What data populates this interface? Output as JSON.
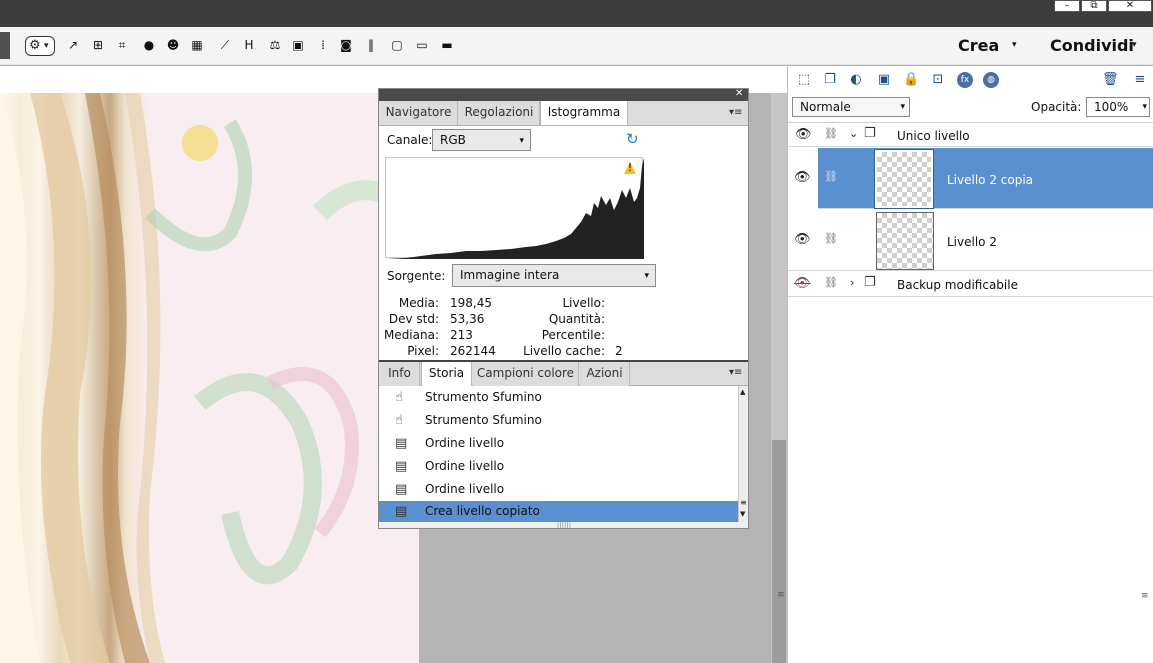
{
  "window": {
    "minimize": "–",
    "restore": "⧉",
    "close": "✕"
  },
  "toolbar": {
    "icons": [
      "gear-icon",
      "external-icon",
      "dashboard-icon",
      "crop-icon",
      "person-icon",
      "smile-icon",
      "grid-icon",
      "chart-icon",
      "h-icon",
      "balance-icon",
      "image-icon",
      "dots-icon",
      "camera-icon",
      "pause-icon",
      "frame-icon",
      "laptop-icon",
      "monitor-icon"
    ],
    "glyphs": [
      "⚙",
      "↗",
      "⊞",
      "⌗",
      "●",
      "☻",
      "▦",
      "⟋",
      "H",
      "⚖",
      "▣",
      "⁞",
      "◙",
      "‖",
      "▢",
      "▭",
      "▬"
    ],
    "crea_label": "Crea",
    "condividi_label": "Condividi",
    "caret": "▾"
  },
  "layers_panel": {
    "icons": [
      "new-layer-icon",
      "duplicate-icon",
      "paint-icon",
      "mask-icon",
      "lock-icon",
      "lock-transparency-icon",
      "fx-icon",
      "layer-style-icon",
      "trash-icon",
      "menu-icon"
    ],
    "glyphs": [
      "⬚",
      "❐",
      "◐",
      "▣",
      "🔒",
      "⊡",
      "fx",
      "◍",
      "🗑",
      "≡"
    ],
    "blend_mode": "Normale",
    "opacity_label": "Opacità:",
    "opacity_value": "100%",
    "rows": [
      {
        "name": "Unico livello",
        "type": "group"
      },
      {
        "name": "Livello 2 copia",
        "type": "layer",
        "selected": true
      },
      {
        "name": "Livello 2",
        "type": "layer",
        "selected": false
      },
      {
        "name": "Backup modificabile",
        "type": "group"
      }
    ]
  },
  "float_panel": {
    "tabs_top": [
      "Navigatore",
      "Regolazioni",
      "Istogramma"
    ],
    "active_top": "Istogramma",
    "canale_label": "Canale:",
    "canale_value": "RGB",
    "sorgente_label": "Sorgente:",
    "sorgente_value": "Immagine intera",
    "warning": "!",
    "stats_left": [
      {
        "k": "Media:",
        "v": "198,45"
      },
      {
        "k": "Dev std:",
        "v": "53,36"
      },
      {
        "k": "Mediana:",
        "v": "213"
      },
      {
        "k": "Pixel:",
        "v": "262144"
      }
    ],
    "stats_right": [
      {
        "k": "Livello:",
        "v": ""
      },
      {
        "k": "Quantità:",
        "v": ""
      },
      {
        "k": "Percentile:",
        "v": ""
      },
      {
        "k": "Livello cache:",
        "v": "2"
      }
    ],
    "tabs_bottom": [
      "Info",
      "Storia",
      "Campioni colore",
      "Azioni"
    ],
    "active_bottom": "Storia",
    "history": [
      {
        "label": "Strumento Sfumino",
        "icon": "smudge-icon"
      },
      {
        "label": "Strumento Sfumino",
        "icon": "smudge-icon"
      },
      {
        "label": "Ordine livello",
        "icon": "layer-order-icon"
      },
      {
        "label": "Ordine livello",
        "icon": "layer-order-icon"
      },
      {
        "label": "Ordine livello",
        "icon": "layer-order-icon"
      },
      {
        "label": "Crea livello copiato",
        "icon": "layer-order-icon",
        "selected": true
      }
    ]
  }
}
